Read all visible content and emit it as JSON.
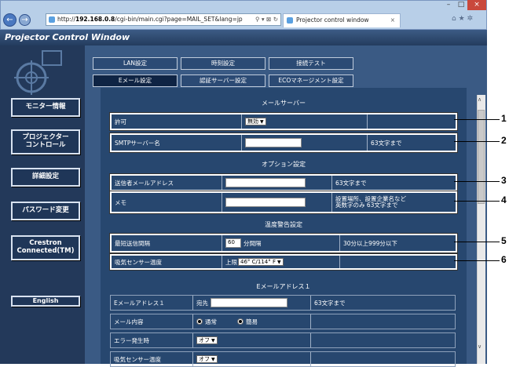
{
  "browser": {
    "url_prefix": "http://",
    "url_host": "192.168.0.8",
    "url_path": "/cgi-bin/main.cgi?page=MAIL_SET&lang=jp",
    "address_controls": "⚲ ▾ ⊠ ↻",
    "tab_title": "Projector control window",
    "tab_close": "×",
    "back": "←",
    "forward": "→",
    "icons_right": "⌂ ★ ✲",
    "win_min": "–",
    "win_max": "□",
    "win_close": "×"
  },
  "window_title": "Projector Control Window",
  "sidebar": {
    "items": [
      {
        "label": "モニター情報"
      },
      {
        "label": "プロジェクター\nコントロール"
      },
      {
        "label": "詳細設定"
      },
      {
        "label": "パスワード変更"
      },
      {
        "label": "Crestron\nConnected(TM)"
      },
      {
        "label": "English"
      }
    ]
  },
  "tabs_row1": [
    "LAN設定",
    "時刻設定",
    "接続テスト"
  ],
  "tabs_row2": [
    "Eメール設定",
    "認証サーバー設定",
    "ECOマネージメント設定"
  ],
  "sections": {
    "mail_server": "メールサーバー",
    "options": "オプション設定",
    "temp_warning": "温度警告設定",
    "email1": "Eメールアドレス１"
  },
  "rows": {
    "permit": {
      "label": "許可",
      "value": "無効"
    },
    "smtp": {
      "label": "SMTPサーバー名",
      "hint": "63文字まで"
    },
    "sender": {
      "label": "送信者メールアドレス",
      "hint": "63文字まで"
    },
    "memo": {
      "label": "メモ",
      "hint_line1": "設置場所、設置企業名など",
      "hint_line2": "英数字のみ 63文字まで"
    },
    "interval": {
      "label": "最短送信間隔",
      "value": "60",
      "unit": "分間隔",
      "hint": "30分以上999分以下"
    },
    "intake_temp": {
      "label": "吸気センサー温度",
      "prefix": "上限",
      "value": "46° C/114° F"
    },
    "email1_addr": {
      "label": "Eメールアドレス１",
      "prefix": "宛先",
      "hint": "63文字まで"
    },
    "mail_content": {
      "label": "メール内容",
      "opt1": "通常",
      "opt2": "簡易"
    },
    "error_time": {
      "label": "エラー発生時",
      "value": "オフ"
    },
    "intake_temp2": {
      "label": "吸気センサー温度",
      "value": "オフ"
    }
  },
  "callouts": [
    "1",
    "2",
    "3",
    "4",
    "5",
    "6"
  ]
}
